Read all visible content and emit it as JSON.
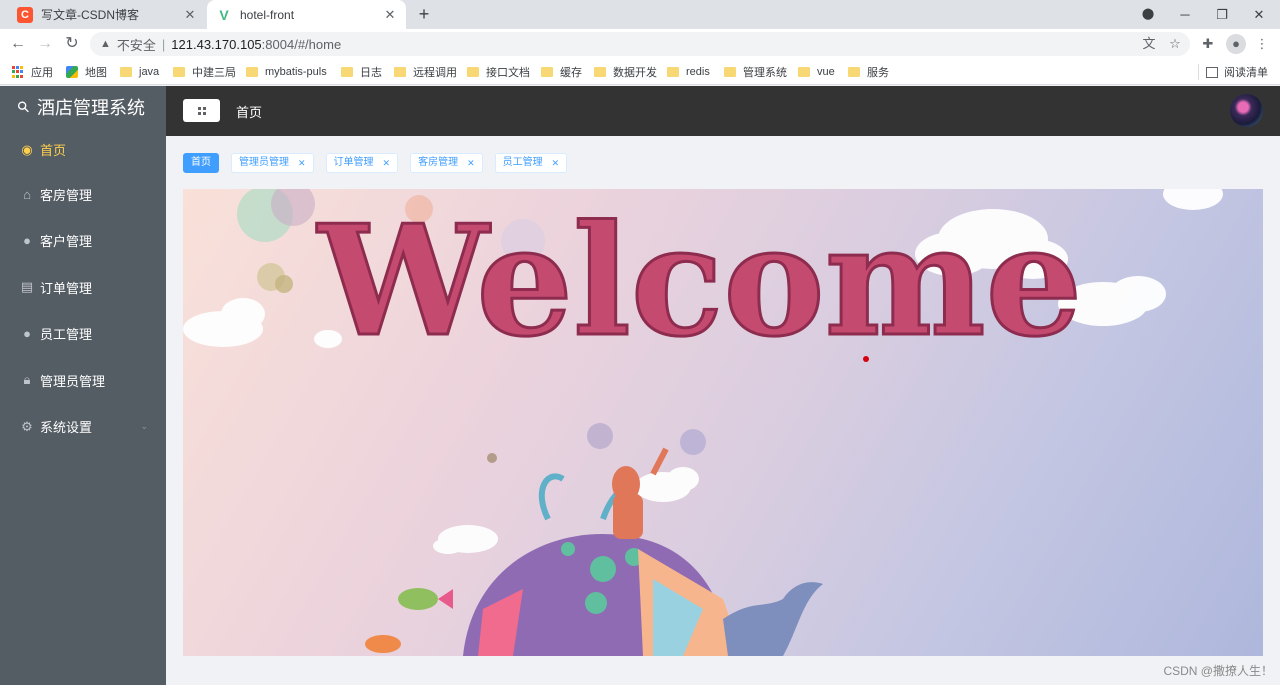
{
  "browser": {
    "tabs": [
      {
        "title": "写文章-CSDN博客",
        "favicon": "C",
        "favicon_color": "#fc5531",
        "active": false
      },
      {
        "title": "hotel-front",
        "favicon": "V",
        "favicon_color": "#42b883",
        "active": true
      }
    ],
    "address": {
      "security_label": "不安全",
      "host": "121.43.170.105",
      "path": ":8004/#/home"
    },
    "bookmarks": [
      {
        "label": "应用",
        "icon": "apps-icon"
      },
      {
        "label": "地图",
        "icon": "maps-icon"
      },
      {
        "label": "java",
        "icon": "folder-icon"
      },
      {
        "label": "中建三局",
        "icon": "folder-icon"
      },
      {
        "label": "mybatis-puls",
        "icon": "folder-icon"
      },
      {
        "label": "日志",
        "icon": "folder-icon"
      },
      {
        "label": "远程调用",
        "icon": "folder-icon"
      },
      {
        "label": "接口文档",
        "icon": "folder-icon"
      },
      {
        "label": "缓存",
        "icon": "folder-icon"
      },
      {
        "label": "数据开发",
        "icon": "folder-icon"
      },
      {
        "label": "redis",
        "icon": "folder-icon"
      },
      {
        "label": "管理系统",
        "icon": "folder-icon"
      },
      {
        "label": "vue",
        "icon": "folder-icon"
      },
      {
        "label": "服务",
        "icon": "folder-icon"
      }
    ],
    "reading_list": "阅读清单"
  },
  "sidebar": {
    "title": "酒店管理系统",
    "items": [
      {
        "label": "首页",
        "icon": "eye-icon",
        "active": true
      },
      {
        "label": "客房管理",
        "icon": "home-icon",
        "active": false
      },
      {
        "label": "客户管理",
        "icon": "user-icon",
        "active": false
      },
      {
        "label": "订单管理",
        "icon": "document-icon",
        "active": false
      },
      {
        "label": "员工管理",
        "icon": "user-icon",
        "active": false
      },
      {
        "label": "管理员管理",
        "icon": "lock-icon",
        "active": false
      },
      {
        "label": "系统设置",
        "icon": "gear-icon",
        "active": false,
        "expandable": true
      }
    ]
  },
  "header": {
    "title": "首页"
  },
  "tags": [
    {
      "label": "首页",
      "active": true,
      "closable": false
    },
    {
      "label": "管理员管理",
      "active": false,
      "closable": true
    },
    {
      "label": "订单管理",
      "active": false,
      "closable": true
    },
    {
      "label": "客房管理",
      "active": false,
      "closable": true
    },
    {
      "label": "员工管理",
      "active": false,
      "closable": true
    }
  ],
  "banner": {
    "text": "Welcome"
  },
  "watermark": "CSDN @撒撩人生！",
  "colors": {
    "sidebar_bg": "#545c64",
    "active_menu": "#ffd04b",
    "header_bg": "#333333",
    "tag_primary": "#409eff"
  }
}
